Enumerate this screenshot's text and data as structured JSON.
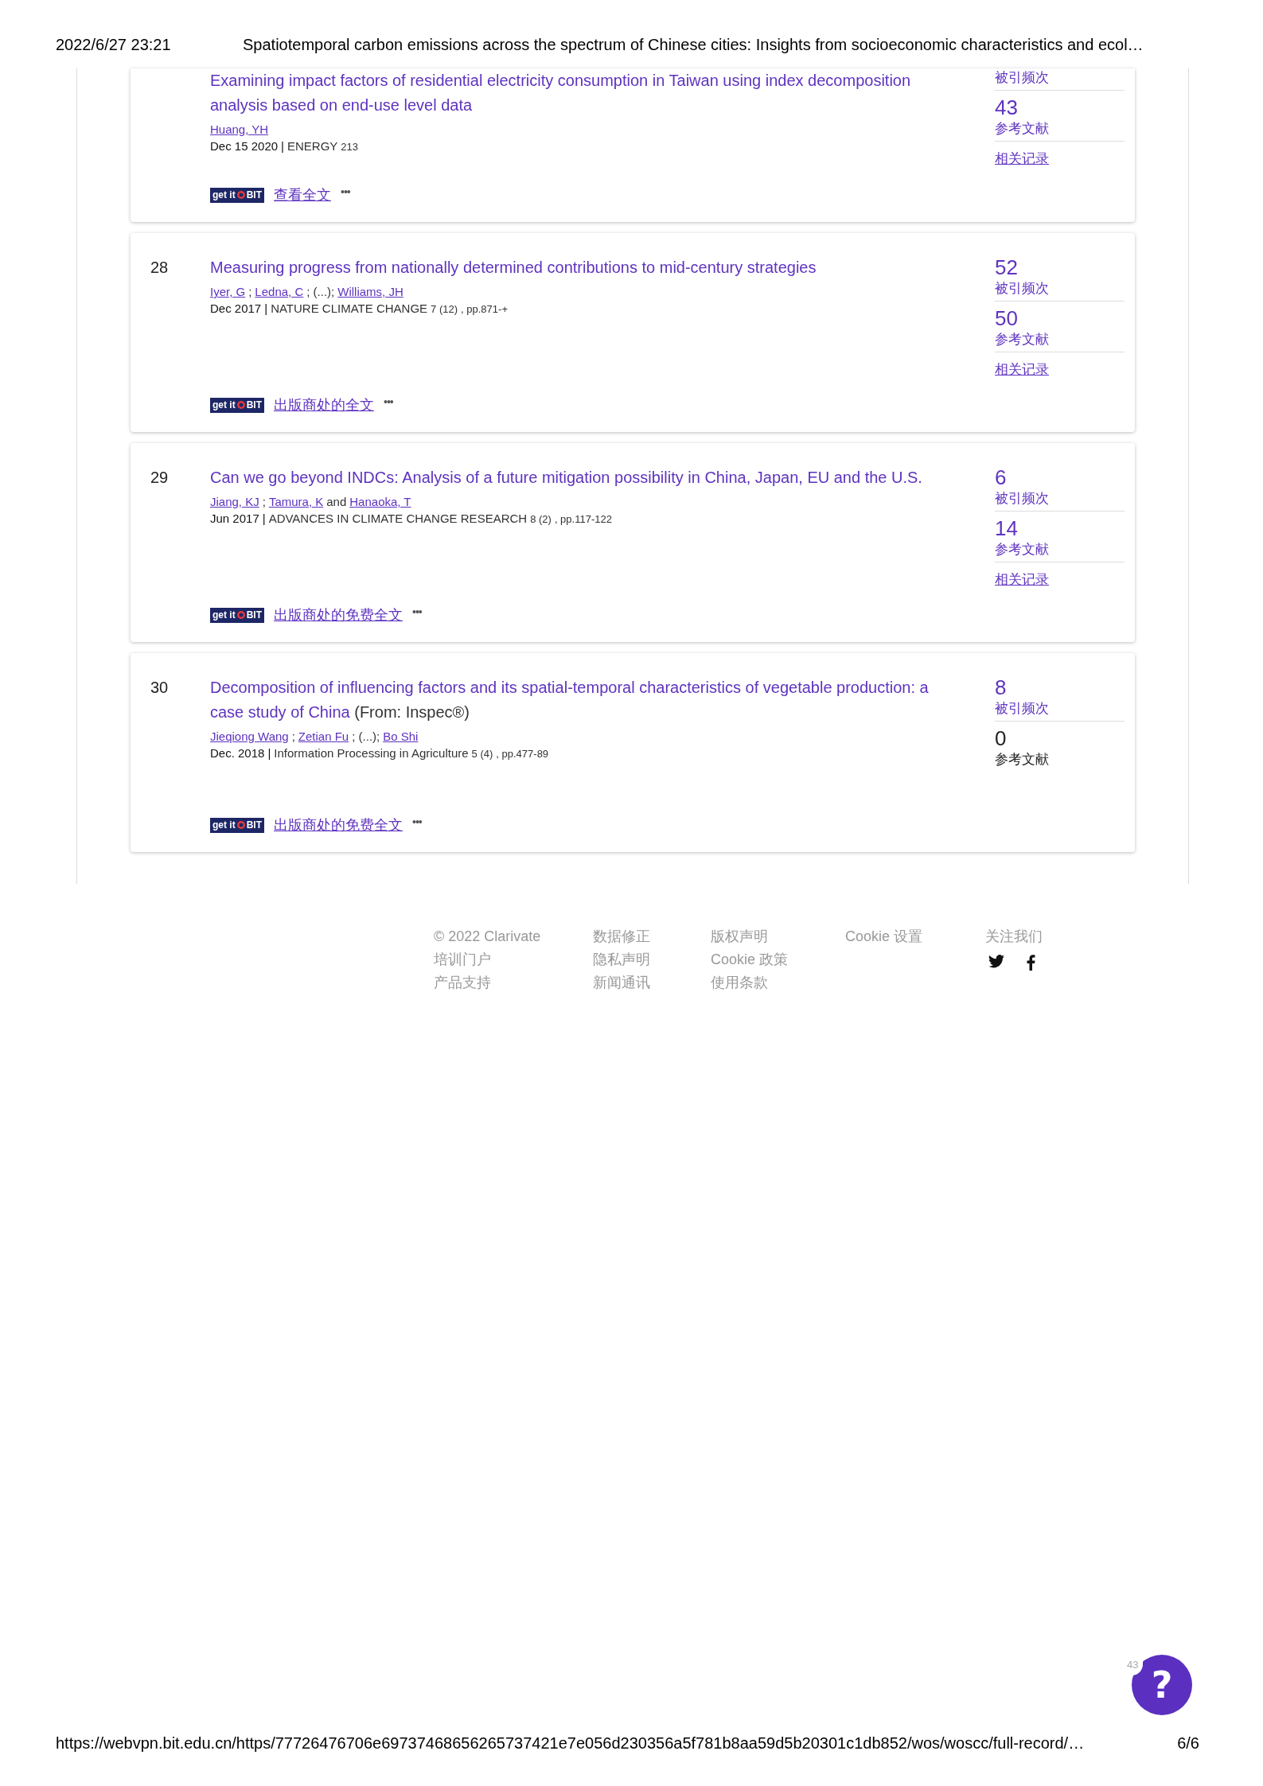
{
  "print_header": {
    "date": "2022/6/27 23:21",
    "title": "Spatiotemporal carbon emissions across the spectrum of Chinese cities: Insights from socioeconomic characteristics and ecol…"
  },
  "records": [
    {
      "cut": true,
      "title": "Examining impact factors of residential electricity consumption in Taiwan using index decomposition analysis based on end-use level data",
      "authors": [
        {
          "kind": "author",
          "text": "Huang, YH"
        }
      ],
      "date": "Dec 15 2020",
      "separator": "|",
      "journal": "ENERGY",
      "volume": "213",
      "logo": {
        "left": "get it",
        "right": "BIT"
      },
      "fulltext": "查看全文",
      "more": "•••",
      "metrics": [
        {
          "kind": "count",
          "label": "被引频次",
          "linked": true
        },
        {
          "kind": "count",
          "value": "43",
          "label": "参考文献",
          "linked": true
        },
        {
          "kind": "link",
          "label": "相关记录"
        }
      ]
    },
    {
      "cut": false,
      "number": "28",
      "title": "Measuring progress from nationally determined contributions to mid-century strategies",
      "authors": [
        {
          "kind": "author",
          "text": "Iyer, G"
        },
        {
          "kind": "separator",
          "text": ";"
        },
        {
          "kind": "author",
          "text": "Ledna, C"
        },
        {
          "kind": "separator",
          "text": "; (...);"
        },
        {
          "kind": "author",
          "text": "Williams, JH"
        }
      ],
      "date": "Dec 2017",
      "separator": "|",
      "journal": "NATURE CLIMATE CHANGE",
      "volume": "7 (12)",
      "pages": ", pp.871-+",
      "logo": {
        "left": "get it",
        "right": "BIT"
      },
      "fulltext": "出版商处的全文",
      "more": "•••",
      "metrics": [
        {
          "kind": "count",
          "value": "52",
          "label": "被引频次",
          "linked": true
        },
        {
          "kind": "count",
          "value": "50",
          "label": "参考文献",
          "linked": true
        },
        {
          "kind": "link",
          "label": "相关记录"
        }
      ]
    },
    {
      "cut": false,
      "number": "29",
      "title": "Can we go beyond INDCs: Analysis of a future mitigation possibility in China, Japan, EU and the U.S.",
      "authors": [
        {
          "kind": "author",
          "text": "Jiang, KJ"
        },
        {
          "kind": "separator",
          "text": ";"
        },
        {
          "kind": "author",
          "text": "Tamura, K"
        },
        {
          "kind": "separator",
          "text": "and"
        },
        {
          "kind": "author",
          "text": "Hanaoka, T"
        }
      ],
      "date": "Jun 2017",
      "separator": "|",
      "journal": "ADVANCES IN CLIMATE CHANGE RESEARCH",
      "volume": "8 (2)",
      "pages": ", pp.117-122",
      "logo": {
        "left": "get it",
        "right": "BIT"
      },
      "fulltext": "出版商处的免费全文",
      "more": "•••",
      "metrics": [
        {
          "kind": "count",
          "value": "6",
          "label": "被引频次",
          "linked": true
        },
        {
          "kind": "count",
          "value": "14",
          "label": "参考文献",
          "linked": true
        },
        {
          "kind": "link",
          "label": "相关记录"
        }
      ]
    },
    {
      "cut": false,
      "number": "30",
      "title": "Decomposition of influencing factors and its spatial-temporal characteristics of vegetable production: a case study of China",
      "source_note": "(From: Inspec®)",
      "authors": [
        {
          "kind": "author",
          "text": "Jieqiong Wang"
        },
        {
          "kind": "separator",
          "text": ";"
        },
        {
          "kind": "author",
          "text": "Zetian Fu"
        },
        {
          "kind": "separator",
          "text": "; (...);"
        },
        {
          "kind": "author",
          "text": "Bo Shi"
        }
      ],
      "date": "Dec. 2018",
      "separator": "|",
      "journal": "Information Processing in Agriculture",
      "volume": "5 (4)",
      "pages": ", pp.477-89",
      "logo": {
        "left": "get it",
        "right": "BIT"
      },
      "fulltext": "出版商处的免费全文",
      "more": "•••",
      "metrics": [
        {
          "kind": "count",
          "value": "8",
          "label": "被引频次",
          "linked": true
        },
        {
          "kind": "count",
          "value": "0",
          "label": "参考文献",
          "linked": false
        }
      ]
    }
  ],
  "footer": {
    "columns": [
      [
        "© 2022 Clarivate",
        "培训门户",
        "产品支持"
      ],
      [
        "数据修正",
        "隐私声明",
        "新闻通讯"
      ],
      [
        "版权声明",
        "Cookie 政策",
        "使用条款"
      ],
      [
        "Cookie 设置"
      ]
    ],
    "follow": "关注我们"
  },
  "help": {
    "badge": "43",
    "symbol": "?"
  },
  "print_footer": {
    "url": "https://webvpn.bit.edu.cn/https/77726476706e69737468656265737421e7e056d230356a5f781b8aa59d5b20301c1db852/wos/woscc/full-record/…",
    "page": "6/6"
  }
}
